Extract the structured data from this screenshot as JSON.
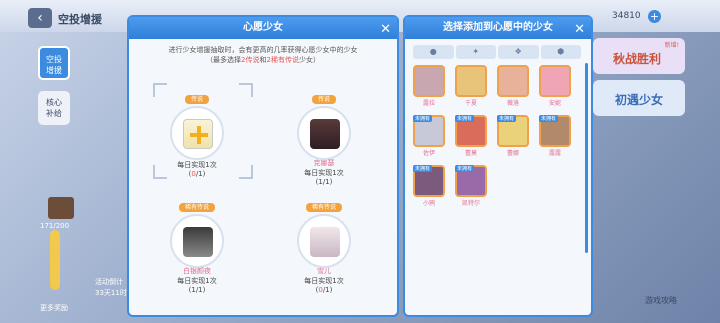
{
  "topbar": {
    "title": "空投增援",
    "back": "‹",
    "currency": "34810",
    "plus": "+"
  },
  "side": {
    "tab1": "空投增援",
    "tab2": "核心补给"
  },
  "bottom_left": {
    "progress": "171/200",
    "event": "活动倒计",
    "event_time": "33天11时",
    "more": "更多奖励"
  },
  "banner": {
    "new_tag": "新增!",
    "top": "秋战胜利",
    "bottom": "初遇少女"
  },
  "wish_panel": {
    "title": "心愿少女",
    "close": "✕",
    "desc1": "进行少女增援抽取时，会有更高的几率获得心愿少女中的少女",
    "desc2_pre": "（最多选择",
    "desc2_n1": "2传说",
    "desc2_mid": "和",
    "desc2_n2": "2稀有传说",
    "desc2_post": "少女）",
    "slots": [
      {
        "tag": "传说",
        "name": "",
        "daily": "每日实现1次",
        "cnt_pre": "(",
        "cnt_num": "0",
        "cnt_post": "/1)"
      },
      {
        "tag": "传说",
        "name": "克娜瑟",
        "daily": "每日实现1次",
        "cnt_pre": "(",
        "cnt_num": "1",
        "cnt_post": "/1)"
      },
      {
        "tag": "稀有传说",
        "name": "白银颜夜",
        "daily": "每日实现1次",
        "cnt_pre": "(",
        "cnt_num": "1",
        "cnt_post": "/1)"
      },
      {
        "tag": "稀有传说",
        "name": "雪儿",
        "daily": "每日实现1次",
        "cnt_pre": "(",
        "cnt_num": "0",
        "cnt_post": "/1)"
      }
    ]
  },
  "select_panel": {
    "title": "选择添加到心愿中的少女",
    "close": "✕",
    "tabs": [
      "●",
      "✦",
      "❖",
      "⬢"
    ],
    "girls": [
      {
        "name": "露拉",
        "color": "#c9a7b0"
      },
      {
        "name": "千夏",
        "color": "#e8c47a"
      },
      {
        "name": "薇洛",
        "color": "#e8b19a"
      },
      {
        "name": "安妮",
        "color": "#f0a5b5"
      },
      {
        "name": "佐伊",
        "color": "#c7c9d8"
      },
      {
        "name": "蕾莫",
        "color": "#d96c5a"
      },
      {
        "name": "蕾娜",
        "color": "#e9d27a"
      },
      {
        "name": "露露",
        "color": "#b08a6a"
      },
      {
        "name": "小鸦",
        "color": "#7a5a7d"
      },
      {
        "name": "凯特尔",
        "color": "#9a6aa8"
      }
    ],
    "unowned": "未拥有"
  },
  "guide": "游戏攻略"
}
